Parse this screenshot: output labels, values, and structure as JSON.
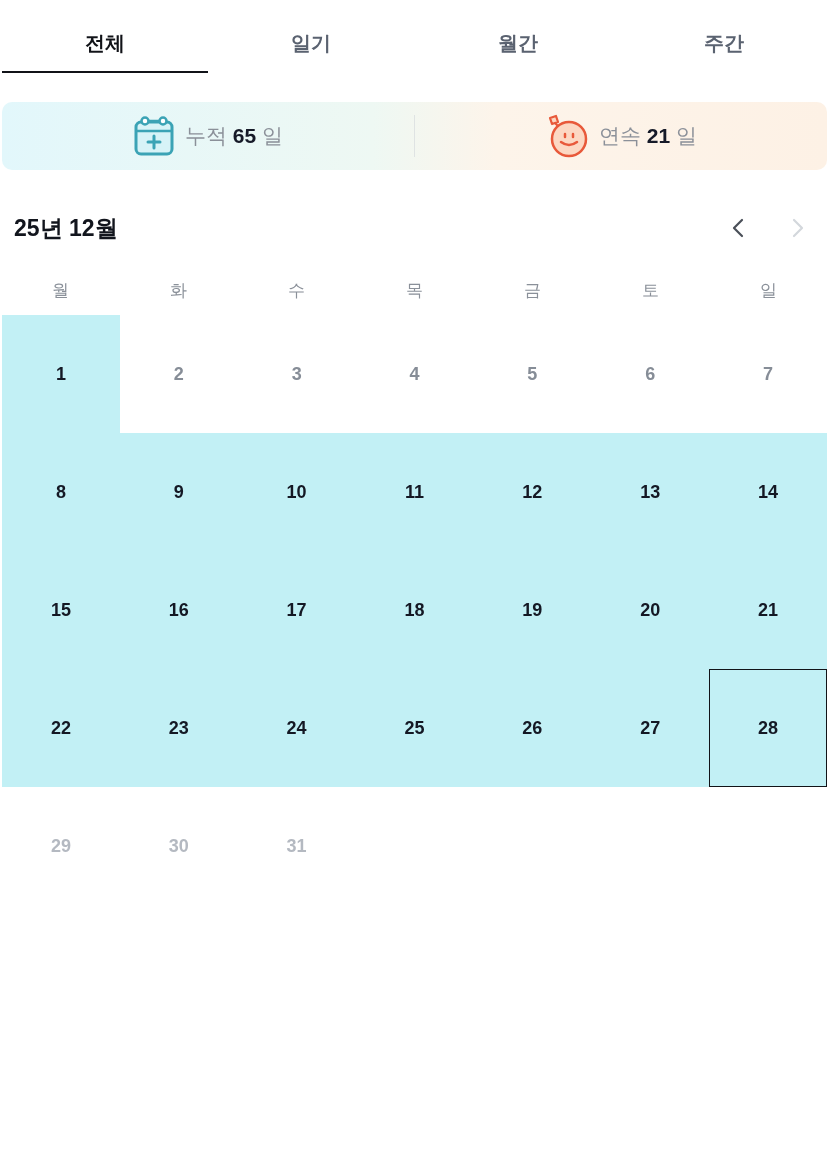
{
  "tabs": [
    {
      "label": "전체",
      "selected": true
    },
    {
      "label": "일기",
      "selected": false
    },
    {
      "label": "월간",
      "selected": false
    },
    {
      "label": "주간",
      "selected": false
    }
  ],
  "stats": [
    {
      "kind": "total",
      "text": "누적 **65** 일"
    },
    {
      "kind": "streak",
      "text": "연속 **21** 일"
    }
  ],
  "calendar": {
    "title": "25년 12월",
    "prev": {
      "disabled": false
    },
    "next": {
      "disabled": true
    },
    "weekdays": [
      "월",
      "화",
      "수",
      "목",
      "금",
      "토",
      "일"
    ],
    "weeks": [
      {
        "days": [
          {
            "label": "1",
            "kind": "recorded",
            "selected": false
          },
          {
            "label": "2",
            "kind": "missed",
            "selected": false
          },
          {
            "label": "3",
            "kind": "missed",
            "selected": false
          },
          {
            "label": "4",
            "kind": "missed",
            "selected": false
          },
          {
            "label": "5",
            "kind": "missed",
            "selected": false
          },
          {
            "label": "6",
            "kind": "missed",
            "selected": false
          },
          {
            "label": "7",
            "kind": "missed",
            "selected": false
          }
        ]
      },
      {
        "days": [
          {
            "label": "8",
            "kind": "recorded",
            "selected": false
          },
          {
            "label": "9",
            "kind": "recorded",
            "selected": false
          },
          {
            "label": "10",
            "kind": "recorded",
            "selected": false
          },
          {
            "label": "11",
            "kind": "recorded",
            "selected": false
          },
          {
            "label": "12",
            "kind": "recorded",
            "selected": false
          },
          {
            "label": "13",
            "kind": "recorded",
            "selected": false
          },
          {
            "label": "14",
            "kind": "recorded",
            "selected": false
          }
        ]
      },
      {
        "days": [
          {
            "label": "15",
            "kind": "recorded",
            "selected": false
          },
          {
            "label": "16",
            "kind": "recorded",
            "selected": false
          },
          {
            "label": "17",
            "kind": "recorded",
            "selected": false
          },
          {
            "label": "18",
            "kind": "recorded",
            "selected": false
          },
          {
            "label": "19",
            "kind": "recorded",
            "selected": false
          },
          {
            "label": "20",
            "kind": "recorded",
            "selected": false
          },
          {
            "label": "21",
            "kind": "recorded",
            "selected": false
          }
        ]
      },
      {
        "days": [
          {
            "label": "22",
            "kind": "recorded",
            "selected": false
          },
          {
            "label": "23",
            "kind": "recorded",
            "selected": false
          },
          {
            "label": "24",
            "kind": "recorded",
            "selected": false
          },
          {
            "label": "25",
            "kind": "recorded",
            "selected": false
          },
          {
            "label": "26",
            "kind": "recorded",
            "selected": false
          },
          {
            "label": "27",
            "kind": "recorded",
            "selected": false
          },
          {
            "label": "28",
            "kind": "recorded",
            "selected": true
          }
        ]
      },
      {
        "days": [
          {
            "label": "29",
            "kind": "upcoming",
            "selected": false
          },
          {
            "label": "30",
            "kind": "upcoming",
            "selected": false
          },
          {
            "label": "31",
            "kind": "upcoming",
            "selected": false
          }
        ]
      }
    ]
  }
}
